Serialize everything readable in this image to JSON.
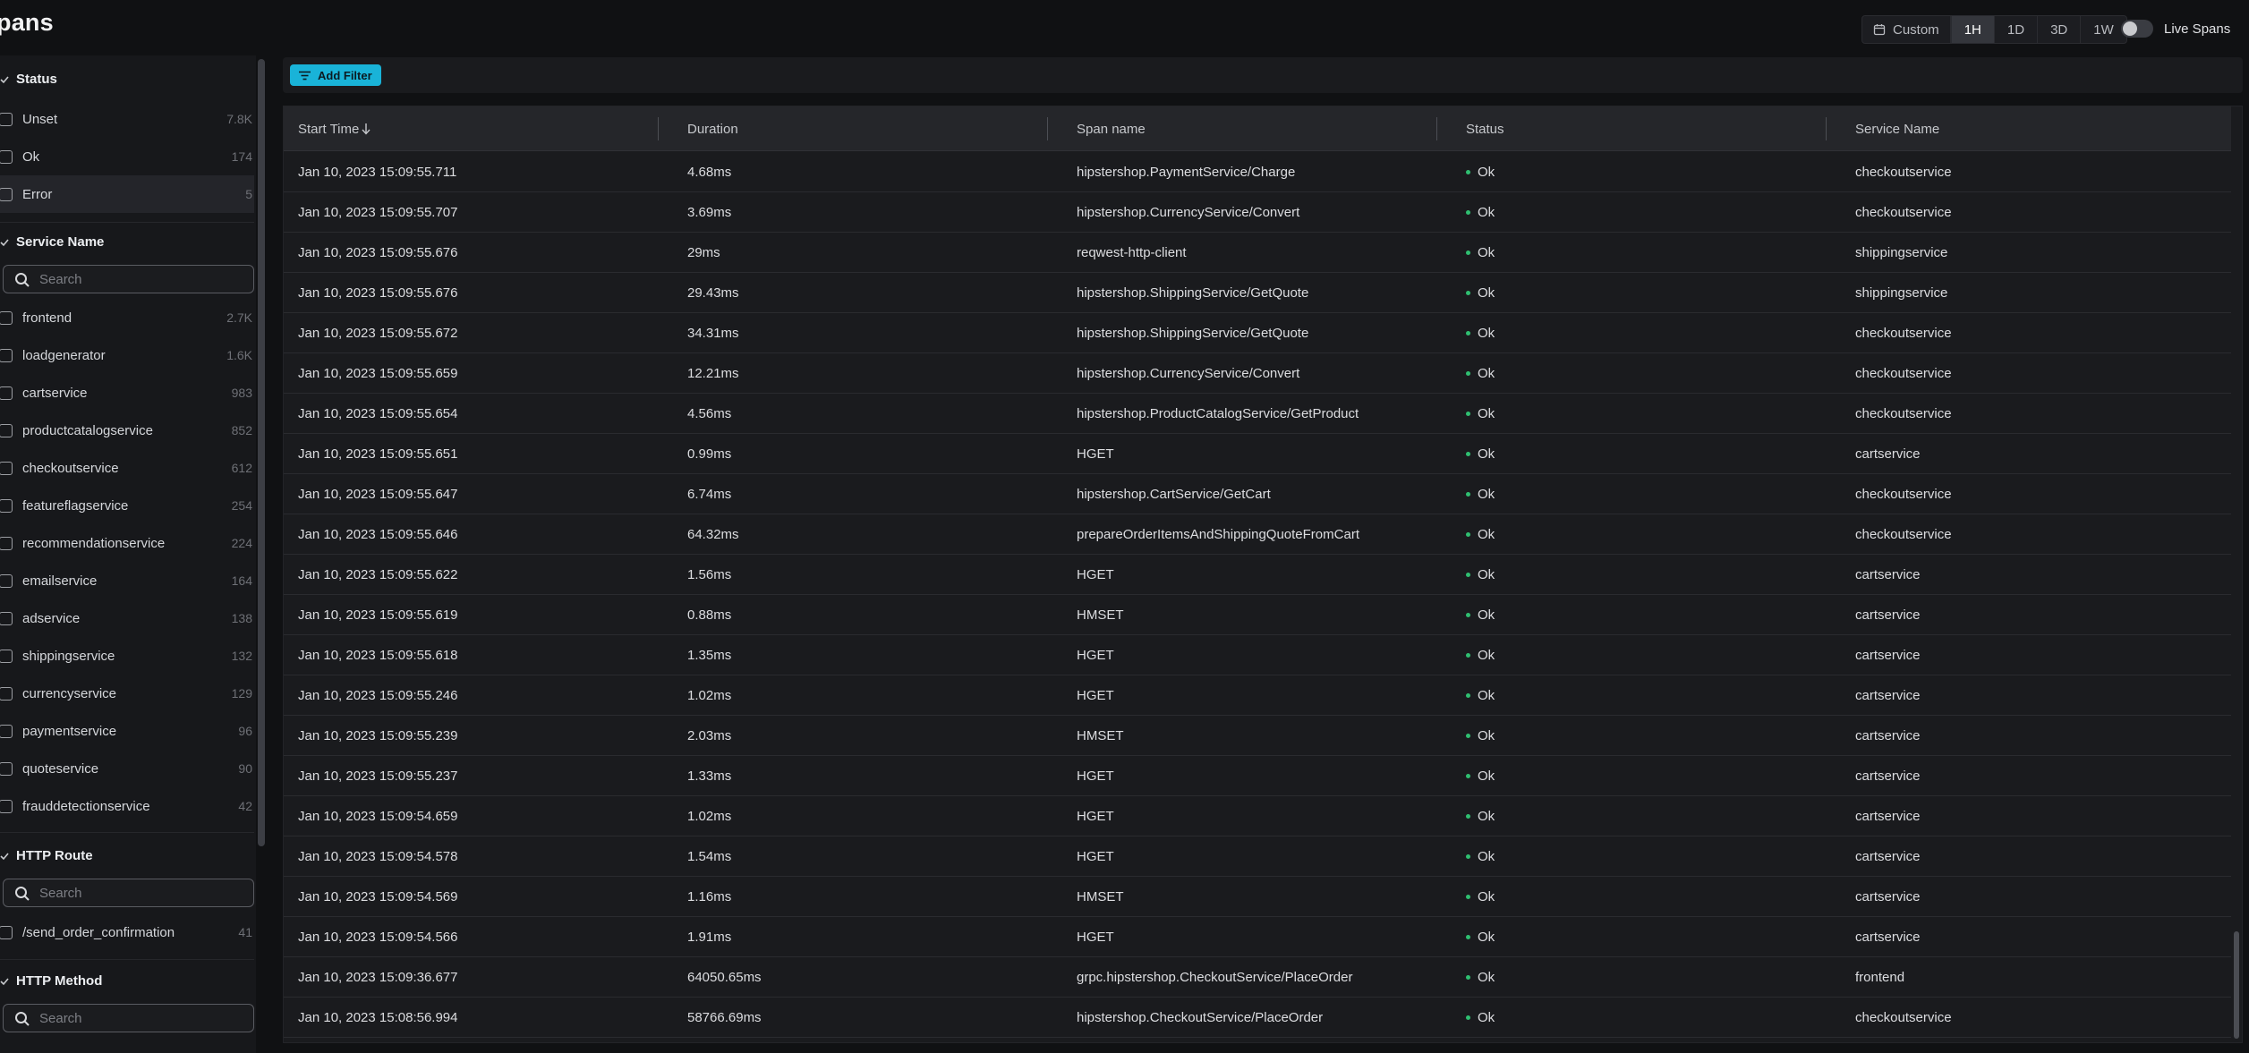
{
  "header": {
    "title": "pans",
    "ranges": [
      "Custom",
      "1H",
      "1D",
      "3D",
      "1W"
    ],
    "active_range": "1H",
    "live_label": "Live Spans"
  },
  "filterbar": {
    "add_filter_label": "Add Filter"
  },
  "sidebar": {
    "status": {
      "title": "Status",
      "items": [
        {
          "label": "Unset",
          "count": "7.8K"
        },
        {
          "label": "Ok",
          "count": "174"
        },
        {
          "label": "Error",
          "count": "5"
        }
      ]
    },
    "service_name": {
      "title": "Service Name",
      "search_placeholder": "Search",
      "items": [
        {
          "label": "frontend",
          "count": "2.7K"
        },
        {
          "label": "loadgenerator",
          "count": "1.6K"
        },
        {
          "label": "cartservice",
          "count": "983"
        },
        {
          "label": "productcatalogservice",
          "count": "852"
        },
        {
          "label": "checkoutservice",
          "count": "612"
        },
        {
          "label": "featureflagservice",
          "count": "254"
        },
        {
          "label": "recommendationservice",
          "count": "224"
        },
        {
          "label": "emailservice",
          "count": "164"
        },
        {
          "label": "adservice",
          "count": "138"
        },
        {
          "label": "shippingservice",
          "count": "132"
        },
        {
          "label": "currencyservice",
          "count": "129"
        },
        {
          "label": "paymentservice",
          "count": "96"
        },
        {
          "label": "quoteservice",
          "count": "90"
        },
        {
          "label": "frauddetectionservice",
          "count": "42"
        }
      ]
    },
    "http_route": {
      "title": "HTTP Route",
      "search_placeholder": "Search",
      "items": [
        {
          "label": "/send_order_confirmation",
          "count": "41"
        }
      ]
    },
    "http_method": {
      "title": "HTTP Method",
      "search_placeholder": "Search"
    }
  },
  "table": {
    "columns": {
      "start_time": "Start Time",
      "duration": "Duration",
      "span_name": "Span name",
      "status": "Status",
      "service_name": "Service Name"
    },
    "rows": [
      [
        "Jan 10, 2023 15:09:55.711",
        "4.68ms",
        "hipstershop.PaymentService/Charge",
        "Ok",
        "checkoutservice"
      ],
      [
        "Jan 10, 2023 15:09:55.707",
        "3.69ms",
        "hipstershop.CurrencyService/Convert",
        "Ok",
        "checkoutservice"
      ],
      [
        "Jan 10, 2023 15:09:55.676",
        "29ms",
        "reqwest-http-client",
        "Ok",
        "shippingservice"
      ],
      [
        "Jan 10, 2023 15:09:55.676",
        "29.43ms",
        "hipstershop.ShippingService/GetQuote",
        "Ok",
        "shippingservice"
      ],
      [
        "Jan 10, 2023 15:09:55.672",
        "34.31ms",
        "hipstershop.ShippingService/GetQuote",
        "Ok",
        "checkoutservice"
      ],
      [
        "Jan 10, 2023 15:09:55.659",
        "12.21ms",
        "hipstershop.CurrencyService/Convert",
        "Ok",
        "checkoutservice"
      ],
      [
        "Jan 10, 2023 15:09:55.654",
        "4.56ms",
        "hipstershop.ProductCatalogService/GetProduct",
        "Ok",
        "checkoutservice"
      ],
      [
        "Jan 10, 2023 15:09:55.651",
        "0.99ms",
        "HGET",
        "Ok",
        "cartservice"
      ],
      [
        "Jan 10, 2023 15:09:55.647",
        "6.74ms",
        "hipstershop.CartService/GetCart",
        "Ok",
        "checkoutservice"
      ],
      [
        "Jan 10, 2023 15:09:55.646",
        "64.32ms",
        "prepareOrderItemsAndShippingQuoteFromCart",
        "Ok",
        "checkoutservice"
      ],
      [
        "Jan 10, 2023 15:09:55.622",
        "1.56ms",
        "HGET",
        "Ok",
        "cartservice"
      ],
      [
        "Jan 10, 2023 15:09:55.619",
        "0.88ms",
        "HMSET",
        "Ok",
        "cartservice"
      ],
      [
        "Jan 10, 2023 15:09:55.618",
        "1.35ms",
        "HGET",
        "Ok",
        "cartservice"
      ],
      [
        "Jan 10, 2023 15:09:55.246",
        "1.02ms",
        "HGET",
        "Ok",
        "cartservice"
      ],
      [
        "Jan 10, 2023 15:09:55.239",
        "2.03ms",
        "HMSET",
        "Ok",
        "cartservice"
      ],
      [
        "Jan 10, 2023 15:09:55.237",
        "1.33ms",
        "HGET",
        "Ok",
        "cartservice"
      ],
      [
        "Jan 10, 2023 15:09:54.659",
        "1.02ms",
        "HGET",
        "Ok",
        "cartservice"
      ],
      [
        "Jan 10, 2023 15:09:54.578",
        "1.54ms",
        "HGET",
        "Ok",
        "cartservice"
      ],
      [
        "Jan 10, 2023 15:09:54.569",
        "1.16ms",
        "HMSET",
        "Ok",
        "cartservice"
      ],
      [
        "Jan 10, 2023 15:09:54.566",
        "1.91ms",
        "HGET",
        "Ok",
        "cartservice"
      ],
      [
        "Jan 10, 2023 15:09:36.677",
        "64050.65ms",
        "grpc.hipstershop.CheckoutService/PlaceOrder",
        "Ok",
        "frontend"
      ],
      [
        "Jan 10, 2023 15:08:56.994",
        "58766.69ms",
        "hipstershop.CheckoutService/PlaceOrder",
        "Ok",
        "checkoutservice"
      ]
    ]
  },
  "colors": {
    "accent": "#19b3d8",
    "status_ok": "#2fbf71",
    "background": "#101113"
  }
}
